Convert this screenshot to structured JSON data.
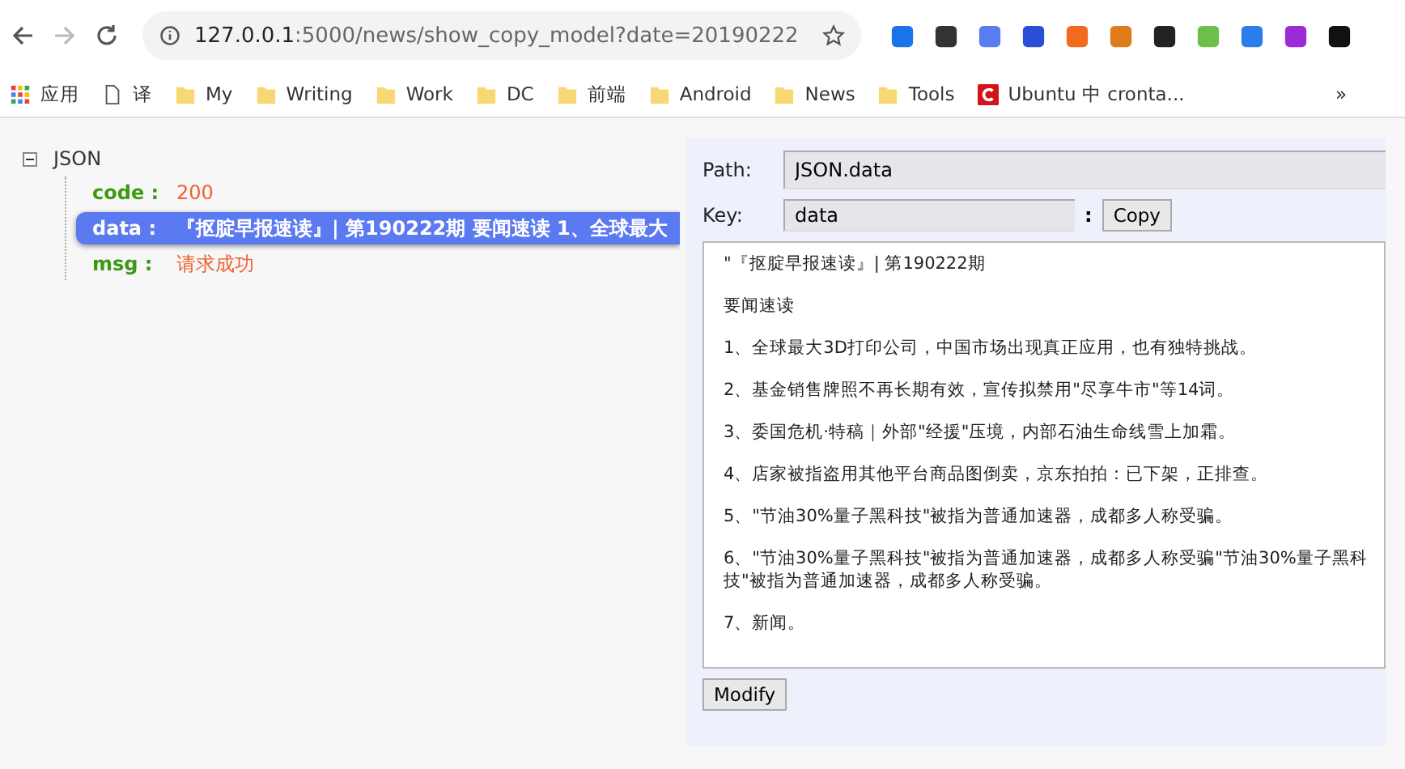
{
  "browser": {
    "url_host": "127.0.0.1",
    "url_rest": ":5000/news/show_copy_model?date=20190222"
  },
  "bookmarks": [
    {
      "kind": "apps",
      "label": "应用"
    },
    {
      "kind": "page",
      "label": "译"
    },
    {
      "kind": "folder",
      "label": "My"
    },
    {
      "kind": "folder",
      "label": "Writing"
    },
    {
      "kind": "folder",
      "label": "Work"
    },
    {
      "kind": "folder",
      "label": "DC"
    },
    {
      "kind": "folder",
      "label": "前端"
    },
    {
      "kind": "folder",
      "label": "Android"
    },
    {
      "kind": "folder",
      "label": "News"
    },
    {
      "kind": "folder",
      "label": "Tools"
    },
    {
      "kind": "site",
      "label": "Ubuntu 中 cronta..."
    }
  ],
  "bookmarks_more": "»",
  "tree": {
    "root": "JSON",
    "expanded": true,
    "children": [
      {
        "key": "code :",
        "value": "200",
        "selected": false
      },
      {
        "key": "data :",
        "value": "『抠腚早报速读』| 第190222期 要闻速读 1、全球最大",
        "selected": true
      },
      {
        "key": "msg :",
        "value": "请求成功",
        "selected": false
      }
    ]
  },
  "editor": {
    "path_label": "Path:",
    "path_value": "JSON.data",
    "key_label": "Key:",
    "key_value": "data",
    "colon": ":",
    "copy_button": "Copy",
    "content": [
      "\"『抠腚早报速读』| 第190222期",
      "要闻速读",
      "1、全球最大3D打印公司，中国市场出现真正应用，也有独特挑战。",
      "2、基金销售牌照不再长期有效，宣传拟禁用\"尽享牛市\"等14词。",
      "3、委国危机·特稿｜外部\"经援\"压境，内部石油生命线雪上加霜。",
      "4、店家被指盗用其他平台商品图倒卖，京东拍拍：已下架，正排查。",
      "5、\"节油30%量子黑科技\"被指为普通加速器，成都多人称受骗。",
      "6、\"节油30%量子黑科技\"被指为普通加速器，成都多人称受骗\"节油30%量子黑科技\"被指为普通加速器，成都多人称受骗。",
      "7、新闻。"
    ],
    "modify_button": "Modify"
  }
}
